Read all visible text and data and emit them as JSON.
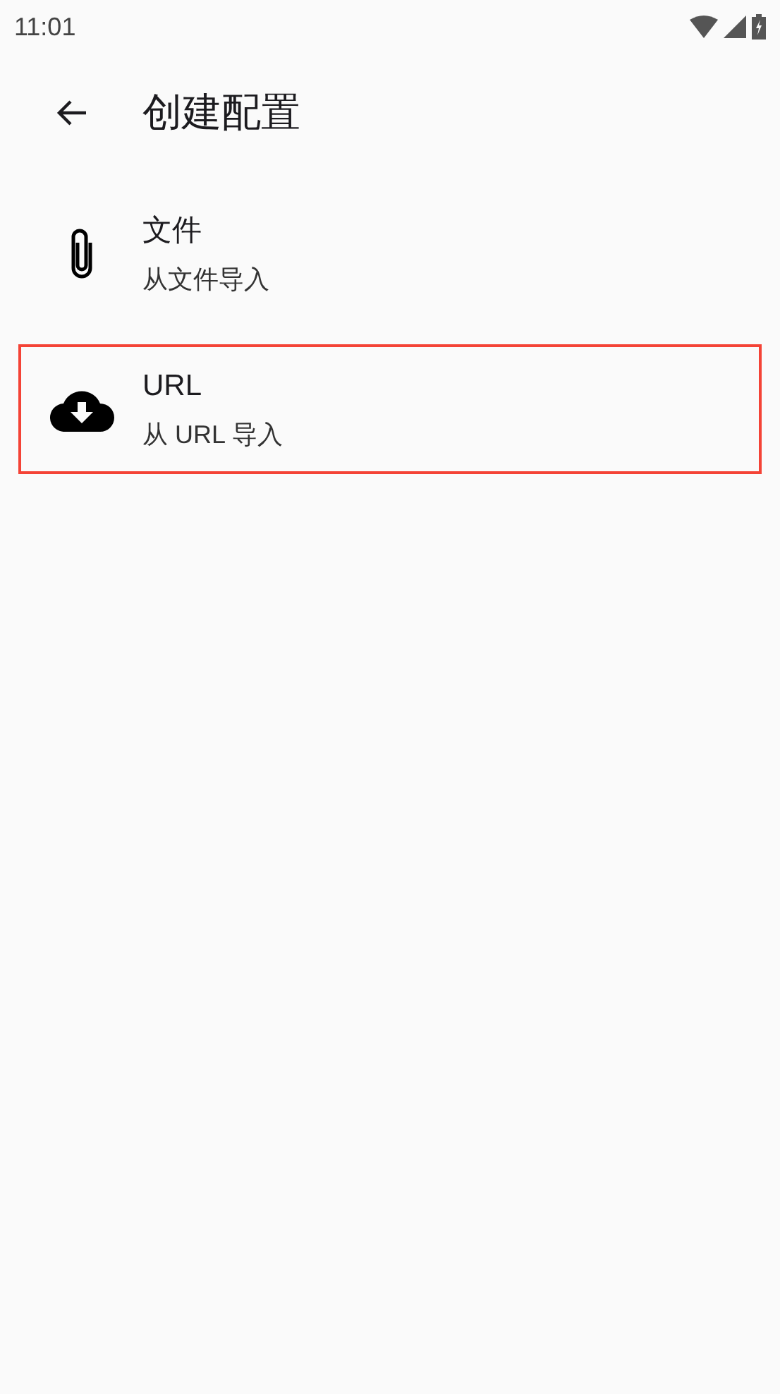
{
  "status_bar": {
    "time": "11:01"
  },
  "app_bar": {
    "title": "创建配置"
  },
  "items": [
    {
      "kind": "file",
      "title": "文件",
      "subtitle": "从文件导入",
      "selected": false
    },
    {
      "kind": "url",
      "title": "URL",
      "subtitle": "从 URL 导入",
      "selected": true
    }
  ]
}
